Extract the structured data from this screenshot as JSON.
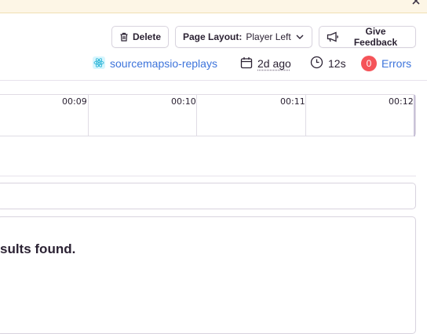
{
  "toolbar": {
    "delete_label": "Delete",
    "layout_prefix": "Page Layout:",
    "layout_value": "Player Left",
    "feedback_label": "Give Feedback"
  },
  "meta": {
    "project": "sourcemapsio-replays",
    "date": "2d ago",
    "duration": "12s",
    "error_count": "0",
    "errors_label": "Errors"
  },
  "timeline": {
    "ticks": [
      "00:09",
      "00:10",
      "00:11",
      "00:12"
    ]
  },
  "results": {
    "empty_message": "sults found."
  },
  "colors": {
    "accent_link": "#3d74db",
    "error_badge": "#f55459",
    "banner_bg": "#fdf6e6"
  },
  "icons": {
    "delete": "trash-icon",
    "layout": "chevron-down-icon",
    "feedback": "megaphone-icon",
    "project": "react-icon",
    "date": "calendar-icon",
    "duration": "clock-icon",
    "close": "close-icon"
  }
}
